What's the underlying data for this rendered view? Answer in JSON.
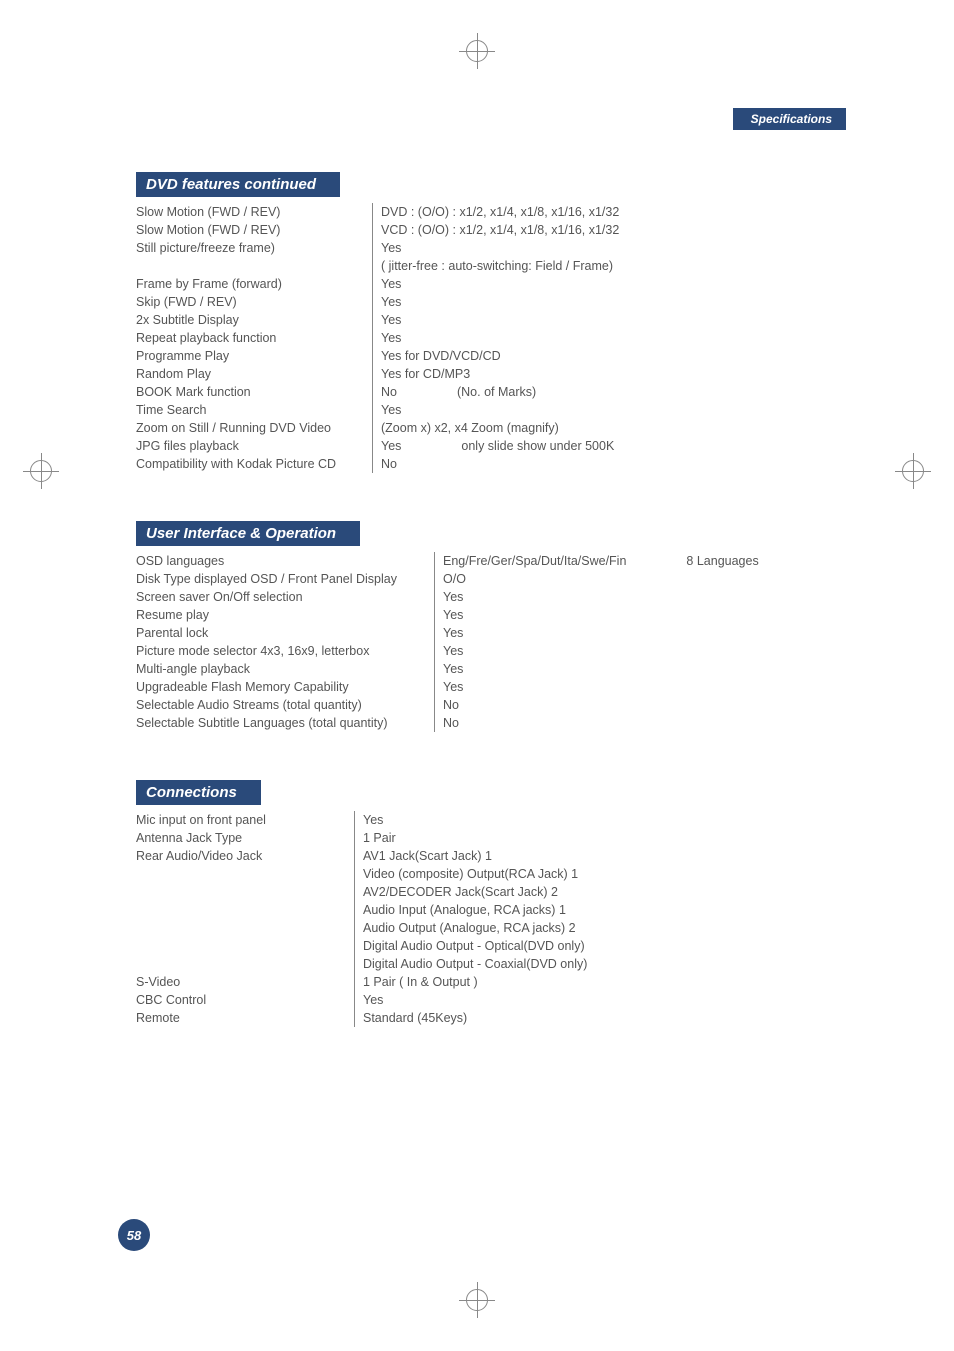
{
  "header": {
    "tag": "Specifications"
  },
  "page_number": "58",
  "sections": {
    "dvd": {
      "title": "DVD features continued",
      "rows": [
        {
          "label": "Slow Motion (FWD / REV)",
          "value": "DVD : (O/O) : x1/2, x1/4, x1/8, x1/16, x1/32"
        },
        {
          "label": "Slow Motion (FWD / REV)",
          "value": "VCD : (O/O) : x1/2, x1/4, x1/8, x1/16, x1/32"
        },
        {
          "label": "Still picture/freeze frame)",
          "value": "Yes"
        },
        {
          "label": "",
          "value": "( jitter-free : auto-switching: Field / Frame)"
        },
        {
          "label": "Frame by Frame (forward)",
          "value": "Yes"
        },
        {
          "label": "Skip (FWD / REV)",
          "value": "Yes"
        },
        {
          "label": "2x Subtitle Display",
          "value": "Yes"
        },
        {
          "label": "Repeat playback function",
          "value": "Yes"
        },
        {
          "label": "Programme Play",
          "value": "Yes for DVD/VCD/CD"
        },
        {
          "label": "Random Play",
          "value": "Yes for CD/MP3"
        },
        {
          "label": "BOOK Mark function",
          "value": "No",
          "value2": "(No. of Marks)"
        },
        {
          "label": "Time Search",
          "value": "Yes"
        },
        {
          "label": "Zoom on Still / Running DVD Video",
          "value": "(Zoom x) x2, x4 Zoom (magnify)"
        },
        {
          "label": "JPG files playback",
          "value": "Yes",
          "value2": "only slide show under 500K"
        },
        {
          "label": "Compatibility with Kodak Picture CD",
          "value": "No"
        }
      ]
    },
    "ui": {
      "title": "User Interface & Operation",
      "rows": [
        {
          "label": "OSD languages",
          "value": "Eng/Fre/Ger/Spa/Dut/Ita/Swe/Fin",
          "value2": "8 Languages"
        },
        {
          "label": "Disk Type displayed  OSD / Front Panel Display",
          "value": "O/O"
        },
        {
          "label": "Screen saver On/Off selection",
          "value": "Yes"
        },
        {
          "label": "Resume play",
          "value": "Yes"
        },
        {
          "label": "Parental lock",
          "value": "Yes"
        },
        {
          "label": "Picture mode selector  4x3, 16x9, letterbox",
          "value": "Yes"
        },
        {
          "label": "Multi-angle playback",
          "value": "Yes"
        },
        {
          "label": "Upgradeable Flash Memory Capability",
          "value": "Yes"
        },
        {
          "label": "Selectable Audio Streams (total quantity)",
          "value": "No"
        },
        {
          "label": "Selectable Subtitle Languages (total quantity)",
          "value": "No"
        }
      ]
    },
    "connections": {
      "title": "Connections",
      "rows": [
        {
          "label": "Mic input on front panel",
          "value": "Yes"
        },
        {
          "label": "Antenna Jack Type",
          "value": "1 Pair"
        },
        {
          "label": "Rear Audio/Video Jack",
          "value": "AV1 Jack(Scart Jack) 1"
        },
        {
          "label": "",
          "value": "Video (composite) Output(RCA Jack) 1"
        },
        {
          "label": "",
          "value": "AV2/DECODER Jack(Scart Jack) 2"
        },
        {
          "label": "",
          "value": "Audio Input (Analogue, RCA jacks) 1"
        },
        {
          "label": "",
          "value": "Audio Output (Analogue, RCA jacks) 2"
        },
        {
          "label": "",
          "value": "Digital Audio Output - Optical(DVD only)"
        },
        {
          "label": "",
          "value": "Digital Audio Output - Coaxial(DVD only)"
        },
        {
          "label": "S-Video",
          "value": "1 Pair ( In & Output )"
        },
        {
          "label": "CBC Control",
          "value": "Yes"
        },
        {
          "label": "Remote",
          "value": "Standard (45Keys)"
        }
      ]
    }
  }
}
